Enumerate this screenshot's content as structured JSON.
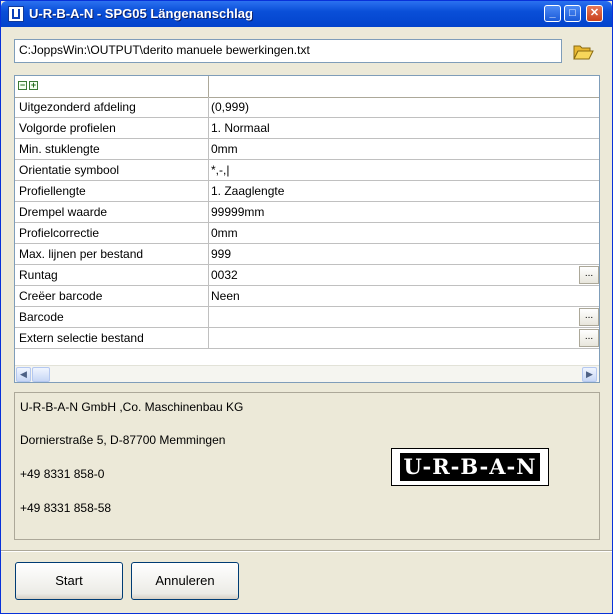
{
  "window": {
    "title": "U-R-B-A-N - SPG05 Längenanschlag"
  },
  "title_buttons": {
    "minimize": "_",
    "maximize": "□",
    "close": "✕"
  },
  "file": {
    "path": "C:JoppsWin:\\OUTPUT\\derito manuele bewerkingen.txt"
  },
  "grid": {
    "expand_icons": [
      "−",
      "+"
    ],
    "ellipsis": "...",
    "rows": [
      {
        "label": "Uitgezonderd afdeling",
        "value": "(0,999)"
      },
      {
        "label": "Volgorde profielen",
        "value": "1. Normaal"
      },
      {
        "label": "Min. stuklengte",
        "value": "0mm"
      },
      {
        "label": "Orientatie symbool",
        "value": "*,-,|"
      },
      {
        "label": "Profiellengte",
        "value": "1. Zaaglengte"
      },
      {
        "label": "Drempel waarde",
        "value": "99999mm"
      },
      {
        "label": "Profielcorrectie",
        "value": "0mm"
      },
      {
        "label": "Max. lijnen per bestand",
        "value": "999"
      },
      {
        "label": "Runtag",
        "value": "0032"
      },
      {
        "label": "Creëer barcode",
        "value": "Neen"
      },
      {
        "label": "Barcode",
        "value": ""
      },
      {
        "label": "Extern selectie bestand",
        "value": ""
      }
    ]
  },
  "company": {
    "name": "U-R-B-A-N GmbH ,Co. Maschinenbau KG",
    "address": "Dornierstraße 5, D-87700 Memmingen",
    "phone": "+49 8331 858-0",
    "fax": "+49 8331 858-58",
    "logo_text": "U-R-B-A-N"
  },
  "buttons": {
    "start": "Start",
    "cancel": "Annuleren"
  },
  "colors": {
    "titlebar": "#0A4FD8",
    "window_bg": "#ECE9D8",
    "grid_line": "#C0C0C0"
  }
}
